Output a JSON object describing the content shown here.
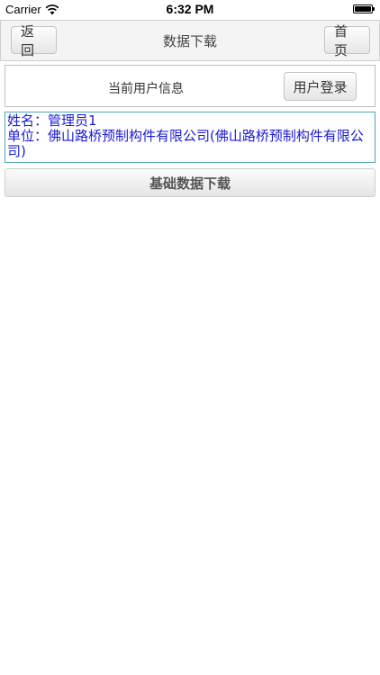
{
  "status_bar": {
    "carrier": "Carrier",
    "time": "6:32 PM",
    "wifi_icon": "wifi-icon",
    "battery_icon": "battery-icon"
  },
  "navbar": {
    "title": "数据下载",
    "back_label": "返回",
    "home_label": "首页"
  },
  "user_panel": {
    "label": "当前用户信息",
    "login_label": "用户登录"
  },
  "user_info": {
    "name_line": "姓名：管理员1",
    "unit_line": "单位：佛山路桥预制构件有限公司(佛山路桥预制构件有限公司)"
  },
  "actions": {
    "download_label": "基础数据下载"
  },
  "colors": {
    "info_text": "#1a1ad6",
    "info_border": "#4fa9b8"
  }
}
